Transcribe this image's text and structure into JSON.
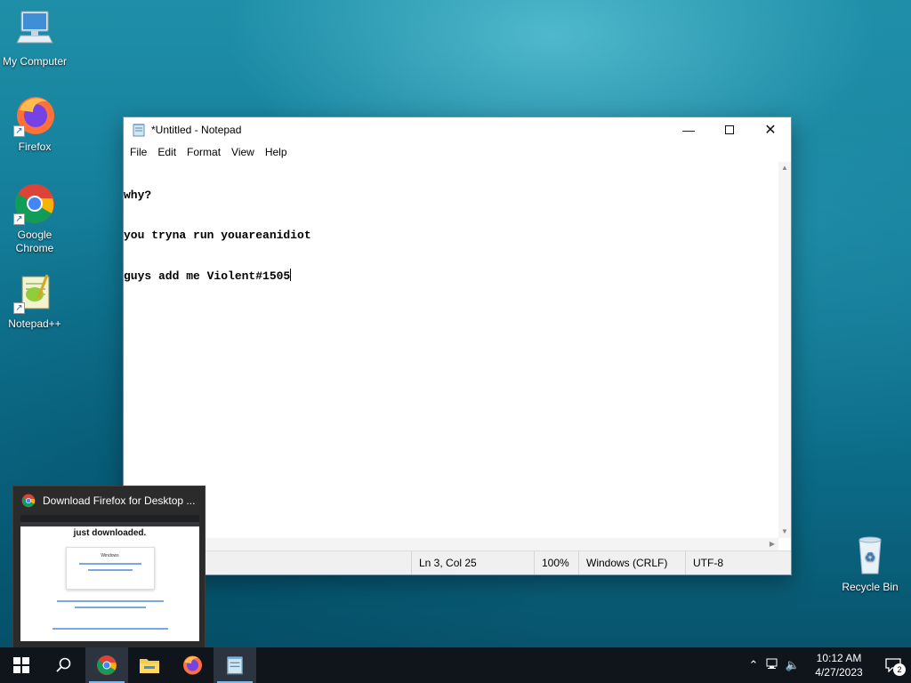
{
  "desktop": {
    "icons": [
      {
        "label": "My Computer"
      },
      {
        "label": "Firefox"
      },
      {
        "label": "Google Chrome"
      },
      {
        "label": "Notepad++"
      },
      {
        "label": "Recycle Bin"
      }
    ]
  },
  "notepad": {
    "title": "*Untitled - Notepad",
    "menu": [
      "File",
      "Edit",
      "Format",
      "View",
      "Help"
    ],
    "lines": [
      "why?",
      "you tryna run youareanidiot",
      "guys add me Violent#1505"
    ],
    "status": {
      "position": "Ln 3, Col 25",
      "zoom": "100%",
      "line_ending": "Windows (CRLF)",
      "encoding": "UTF-8"
    }
  },
  "preview": {
    "title": "Download Firefox for Desktop ...",
    "heading": "just downloaded.",
    "card_text": "Windows"
  },
  "taskbar": {
    "time": "10:12 AM",
    "date": "4/27/2023",
    "notification_count": "2"
  },
  "colors": {
    "accent": "#7fb6e6",
    "taskbar": "#10151c",
    "desktop": "#137c98"
  }
}
